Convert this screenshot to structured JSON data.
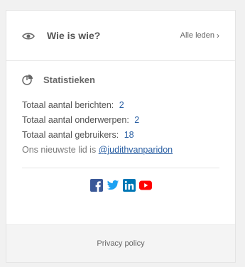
{
  "who_is_who": {
    "title": "Wie is wie?",
    "all_members_link": "Alle leden"
  },
  "statistics": {
    "title": "Statistieken",
    "rows": [
      {
        "label": "Totaal aantal berichten:",
        "value": "2"
      },
      {
        "label": "Totaal aantal onderwerpen:",
        "value": "2"
      },
      {
        "label": "Totaal aantal gebruikers:",
        "value": "18"
      }
    ],
    "newest_prefix": "Ons nieuwste lid is",
    "newest_user": "@judithvanparidon"
  },
  "social": {
    "icons": [
      "facebook-icon",
      "twitter-icon",
      "linkedin-icon",
      "youtube-icon"
    ],
    "colors": {
      "facebook": "#3b5998",
      "twitter": "#1da1f2",
      "linkedin": "#0077b5",
      "youtube": "#ff0000"
    }
  },
  "footer": {
    "privacy_link": "Privacy policy"
  }
}
